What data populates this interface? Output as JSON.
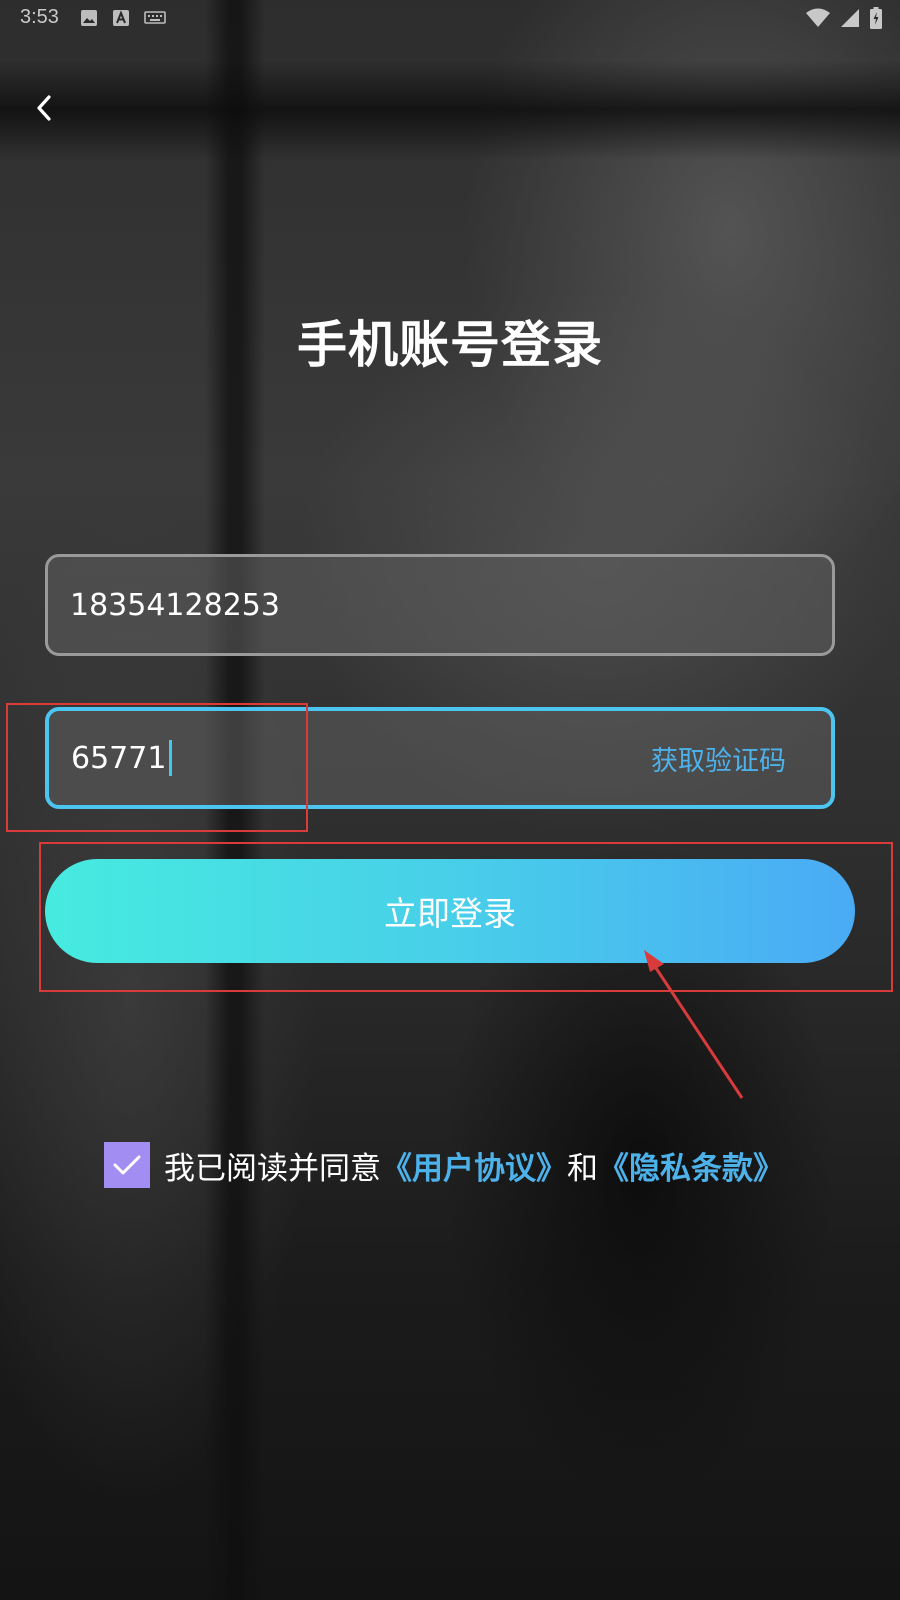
{
  "status_bar": {
    "time": "3:53",
    "left_icons": [
      "image-icon",
      "a-box-icon",
      "keyboard-icon"
    ],
    "right_icons": [
      "wifi-icon",
      "signal-icon",
      "battery-icon"
    ]
  },
  "header": {
    "back_icon": "chevron-left-icon"
  },
  "title": "手机账号登录",
  "phone_field": {
    "value": "18354128253"
  },
  "code_field": {
    "value": "65771",
    "get_code_label": "获取验证码"
  },
  "login_button": {
    "label": "立即登录"
  },
  "agreement": {
    "checked": true,
    "prefix": "我已阅读并同意",
    "user_agreement_link": "《用户协议》",
    "conjunction": "和",
    "privacy_link": "《隐私条款》"
  },
  "colors": {
    "accent_start": "#46ebdf",
    "accent_end": "#4aabf5",
    "link": "#4db1ea",
    "checkbox": "#a28ef2",
    "annotation": "#d93a3a"
  }
}
